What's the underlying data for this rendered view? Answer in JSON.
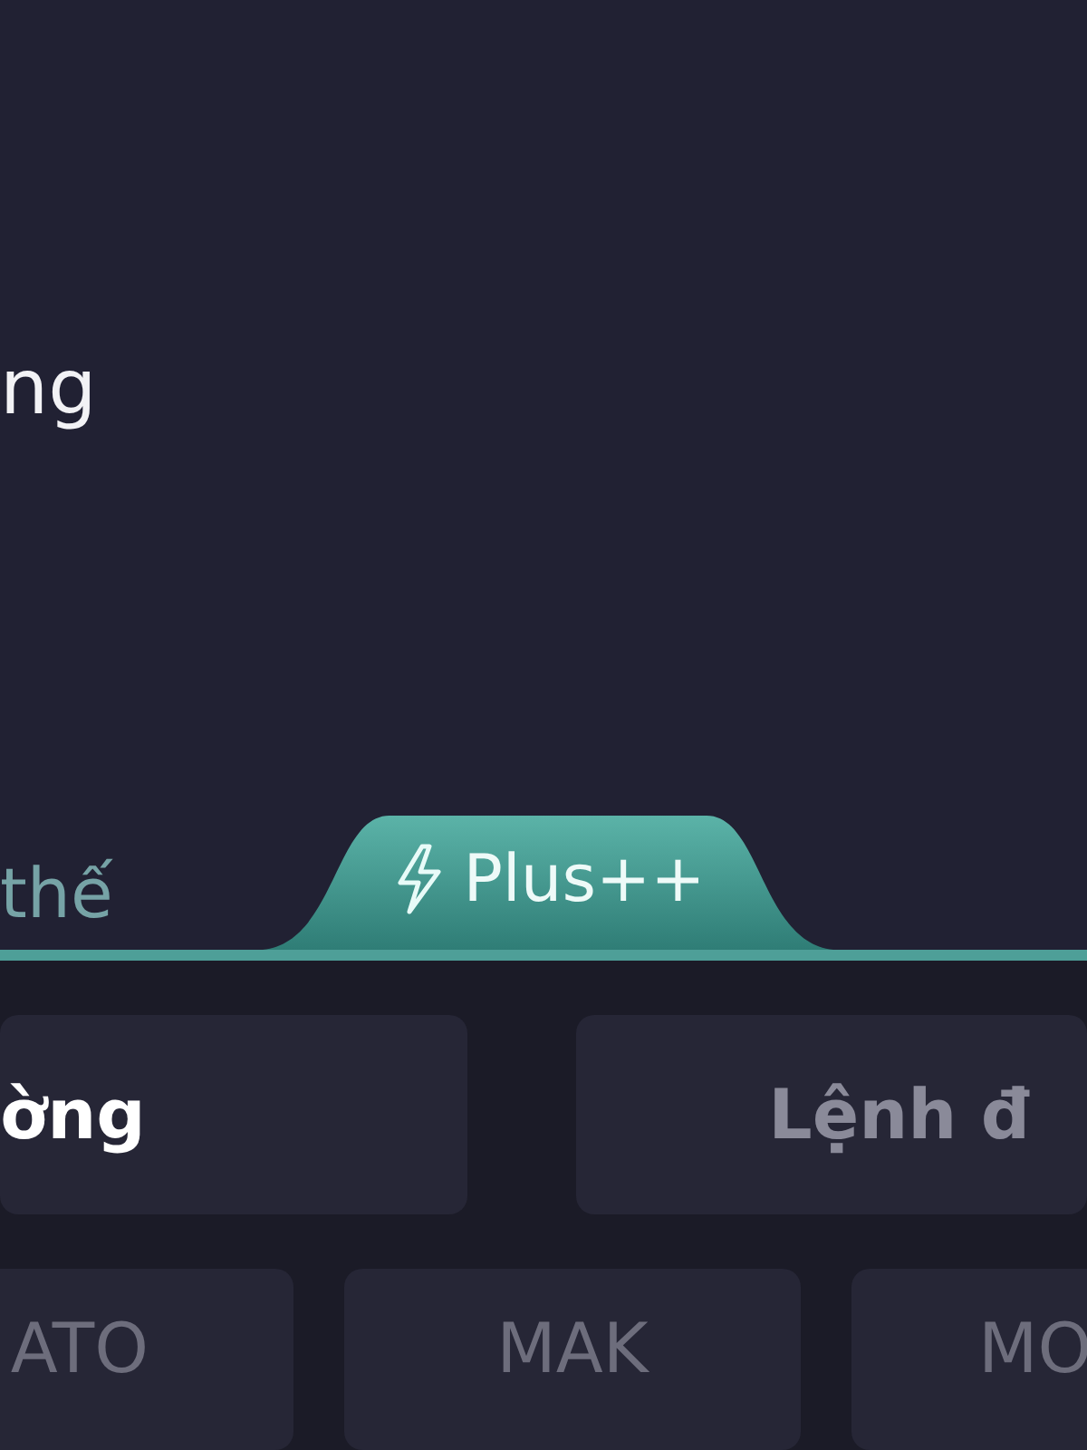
{
  "content": {
    "line_1": "ng",
    "line_2": "thế"
  },
  "plus_tab": {
    "label": "Plus++"
  },
  "order_types": [
    {
      "label": "ờng",
      "selected": true
    },
    {
      "label": "Lệnh đ",
      "selected": false
    }
  ],
  "presets": [
    "ATO",
    "MAK",
    "MO"
  ]
}
